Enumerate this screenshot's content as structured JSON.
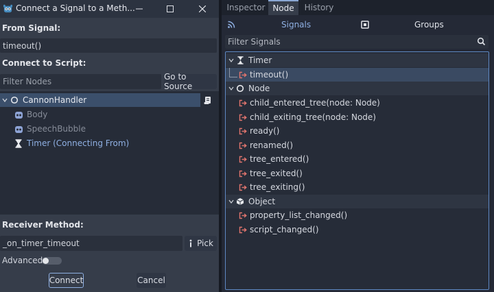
{
  "dialog": {
    "title": "Connect a Signal to a Meth...",
    "from_signal_label": "From Signal:",
    "from_signal_value": "timeout()",
    "connect_to_script_label": "Connect to Script:",
    "filter_nodes_placeholder": "Filter Nodes",
    "go_to_source_label": "Go to Source",
    "tree": [
      {
        "label": "CannonHandler",
        "icon": "node-circle-icon"
      },
      {
        "label": "Body",
        "icon": "sprite-icon"
      },
      {
        "label": "SpeechBubble",
        "icon": "sprite-icon"
      },
      {
        "label": "Timer (Connecting From)",
        "icon": "hourglass-icon"
      }
    ],
    "receiver_method_label": "Receiver Method:",
    "receiver_method_value": "_on_timer_timeout",
    "pick_label": "Pick",
    "advanced_label": "Advanced",
    "advanced_enabled": false,
    "connect_label": "Connect",
    "cancel_label": "Cancel"
  },
  "panel": {
    "tabs": [
      "Inspector",
      "Node",
      "History"
    ],
    "active_tab": "Node",
    "modes": [
      "Signals",
      "Groups"
    ],
    "active_mode": "Signals",
    "filter_placeholder": "Filter Signals",
    "groups": [
      {
        "name": "Timer",
        "icon": "hourglass-icon",
        "signals": [
          "timeout()"
        ]
      },
      {
        "name": "Node",
        "icon": "node-circle-icon",
        "signals": [
          "child_entered_tree(node: Node)",
          "child_exiting_tree(node: Node)",
          "ready()",
          "renamed()",
          "tree_entered()",
          "tree_exited()",
          "tree_exiting()"
        ]
      },
      {
        "name": "Object",
        "icon": "cube-icon",
        "signals": [
          "property_list_changed()",
          "script_changed()"
        ]
      }
    ],
    "selected_signal": "timeout()"
  },
  "colors": {
    "accent": "#8fb0e3",
    "selection": "#3b4f6b",
    "signal_icon": "#e0746d",
    "dialog_bg": "#363d4a",
    "panel_bg": "#242936"
  }
}
